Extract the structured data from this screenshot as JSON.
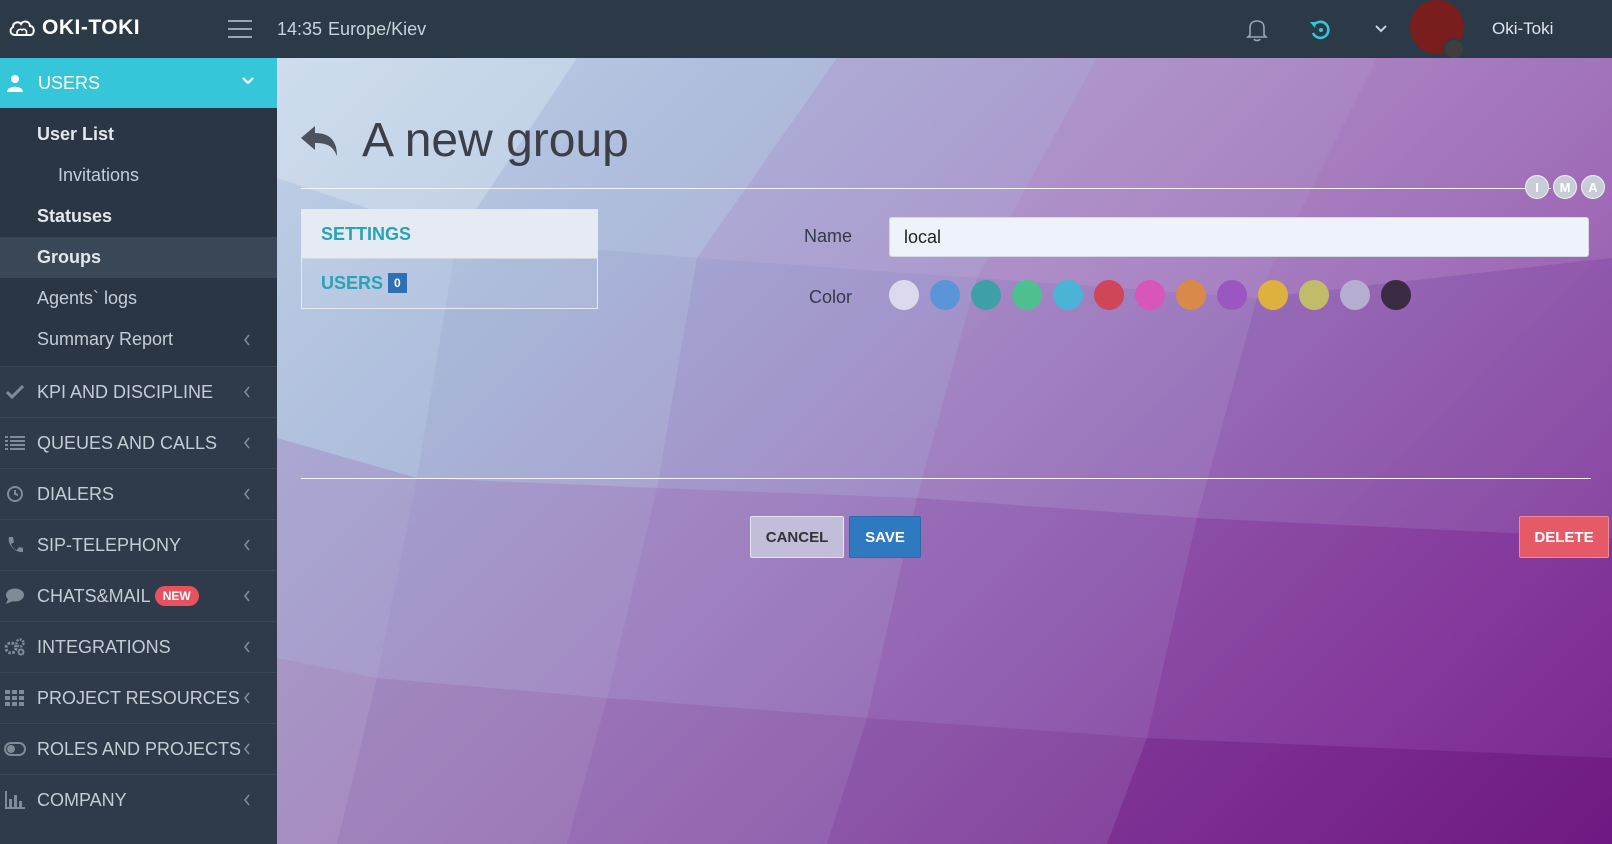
{
  "header": {
    "logo_text": "OKI-TOKI",
    "time": "14:35",
    "timezone": "Europe/Kiev",
    "username": "Oki-Toki",
    "icons": [
      "cloud-logo-icon",
      "hamburger-menu-icon",
      "bell-icon",
      "refresh-icon",
      "chevron-down-icon",
      "avatar"
    ]
  },
  "sidebar": {
    "users_section": {
      "label": "USERS",
      "icon": "user-icon"
    },
    "users_items": [
      {
        "label": "User List"
      },
      {
        "label": "Invitations"
      },
      {
        "label": "Statuses"
      },
      {
        "label": "Groups",
        "active": true
      },
      {
        "label": "Agents` logs"
      },
      {
        "label": "Summary Report"
      }
    ],
    "sections": [
      {
        "label": "KPI AND DISCIPLINE",
        "icon": "check-icon"
      },
      {
        "label": "QUEUES AND CALLS",
        "icon": "list-icon"
      },
      {
        "label": "DIALERS",
        "icon": "clock-icon"
      },
      {
        "label": "SIP-TELEPHONY",
        "icon": "phone-icon"
      },
      {
        "label": "CHATS&MAIL",
        "icon": "chat-icon",
        "badge": "NEW"
      },
      {
        "label": "INTEGRATIONS",
        "icon": "gears-icon"
      },
      {
        "label": "PROJECT RESOURCES",
        "icon": "grid-icon"
      },
      {
        "label": "ROLES AND PROJECTS",
        "icon": "toggle-icon"
      },
      {
        "label": "COMPANY",
        "icon": "bar-chart-icon"
      }
    ]
  },
  "main": {
    "title": "A new group",
    "top_circles": [
      "I",
      "M",
      "A"
    ],
    "tabs": [
      {
        "label": "SETTINGS",
        "active": true
      },
      {
        "label": "USERS",
        "count": "0"
      }
    ],
    "form": {
      "name_label": "Name",
      "name_value": "local",
      "color_label": "Color",
      "colors": [
        "#dcd9ec",
        "#5a95d8",
        "#3f9fa6",
        "#4ec08f",
        "#4bb4d6",
        "#cf4658",
        "#d756b8",
        "#d98a4a",
        "#9a57c2",
        "#ddb13e",
        "#c2bb6a",
        "#b6aed0",
        "#3a2a42"
      ]
    },
    "buttons": {
      "cancel": "CANCEL",
      "save": "SAVE",
      "delete": "DELETE"
    }
  }
}
